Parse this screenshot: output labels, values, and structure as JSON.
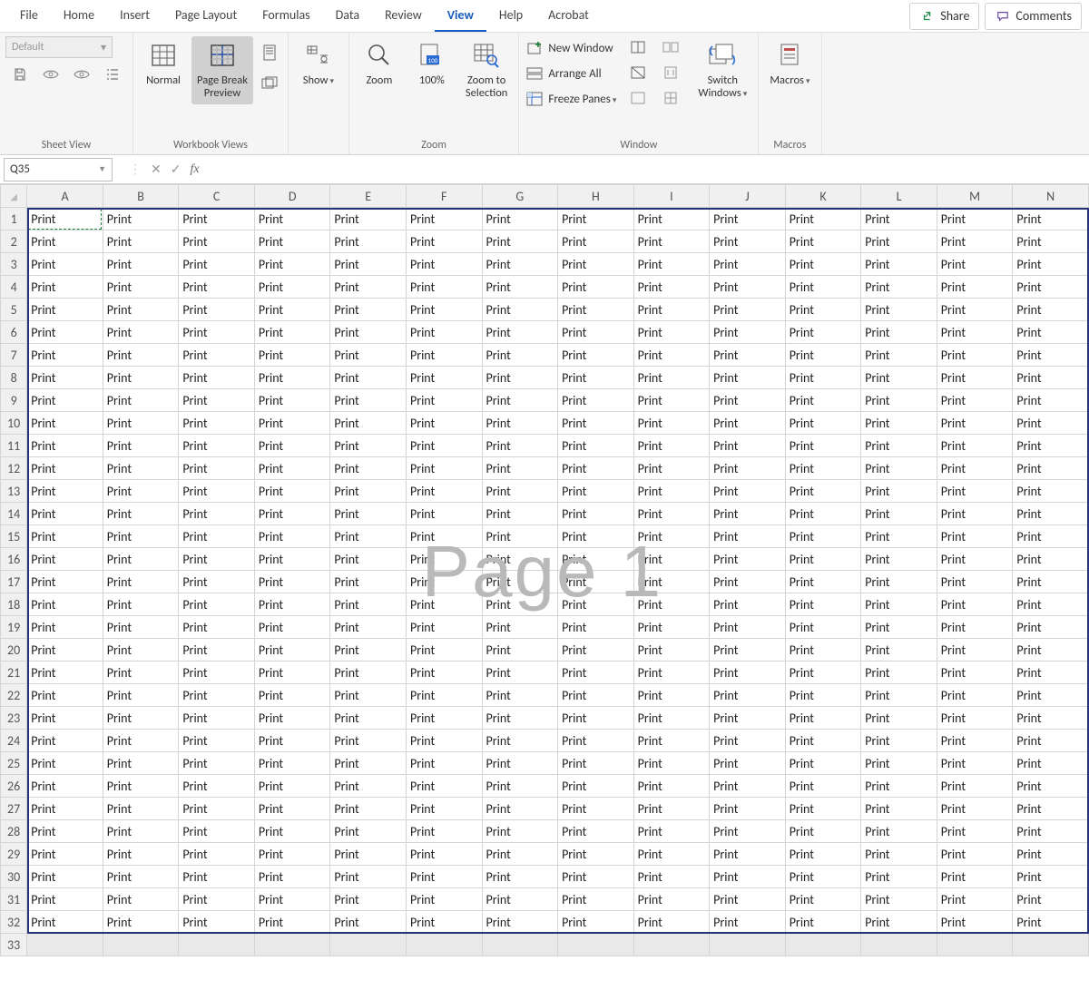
{
  "tabs": {
    "items": [
      "File",
      "Home",
      "Insert",
      "Page Layout",
      "Formulas",
      "Data",
      "Review",
      "View",
      "Help",
      "Acrobat"
    ],
    "active": "View",
    "share": "Share",
    "comments": "Comments"
  },
  "ribbon": {
    "sheet_view": {
      "label": "Sheet View",
      "default_text": "Default"
    },
    "workbook_views": {
      "label": "Workbook Views",
      "normal": "Normal",
      "page_break": "Page Break\nPreview"
    },
    "show": {
      "btn": "Show"
    },
    "zoom": {
      "label": "Zoom",
      "zoom": "Zoom",
      "hundred": "100%",
      "to_sel": "Zoom to\nSelection"
    },
    "window": {
      "label": "Window",
      "new_window": "New Window",
      "arrange_all": "Arrange All",
      "freeze": "Freeze Panes",
      "switch": "Switch\nWindows"
    },
    "macros": {
      "label": "Macros",
      "btn": "Macros"
    }
  },
  "formula_bar": {
    "name_box": "Q35",
    "fx": "fx",
    "value": ""
  },
  "sheet": {
    "columns": [
      "A",
      "B",
      "C",
      "D",
      "E",
      "F",
      "G",
      "H",
      "I",
      "J",
      "K",
      "L",
      "M",
      "N"
    ],
    "row_count": 33,
    "data_rows": 32,
    "cell_value": "Print",
    "watermark": "Page 1",
    "selected_cell": "A1"
  }
}
